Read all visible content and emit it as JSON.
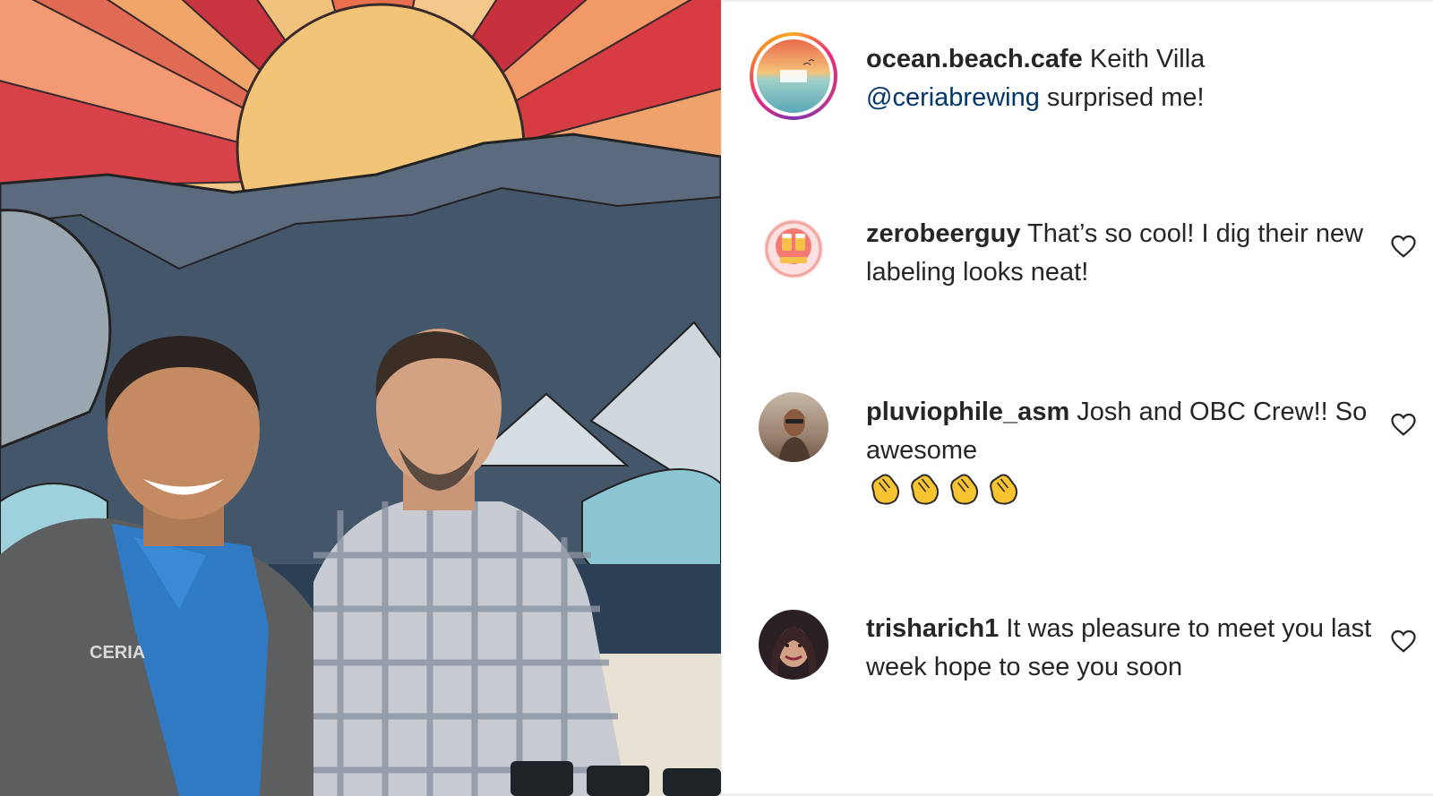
{
  "post": {
    "username": "ocean.beach.cafe",
    "caption_before": " Keith Villa ",
    "mention": "@ceriabrewing",
    "caption_after": " surprised me!"
  },
  "comments": [
    {
      "username": "zerobeerguy",
      "text": " That’s so cool! I dig their new labeling looks neat!",
      "avatar_icon": "beer-mugs-badge-avatar",
      "like_icon": "heart-outline-icon"
    },
    {
      "username": "pluviophile_asm",
      "text": " Josh and OBC Crew!! So awesome",
      "emoji": "👏👏👏👏",
      "avatar_icon": "profile-photo-avatar",
      "like_icon": "heart-outline-icon"
    },
    {
      "username": "trisharich1",
      "text": " It was pleasure to meet you last week hope to see you soon",
      "avatar_icon": "profile-photo-avatar",
      "like_icon": "heart-outline-icon"
    }
  ],
  "photo": {
    "jacket_logo": "CERIA"
  },
  "colors": {
    "text": "#262626",
    "mention": "#00376b",
    "divider": "#efefef"
  }
}
